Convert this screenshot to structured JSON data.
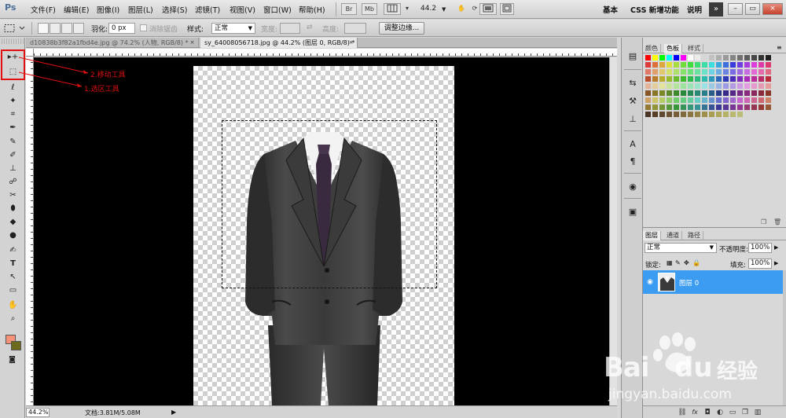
{
  "app": {
    "logo": "Ps"
  },
  "menu": [
    "文件(F)",
    "编辑(E)",
    "图像(I)",
    "图层(L)",
    "选择(S)",
    "滤镜(T)",
    "视图(V)",
    "窗口(W)",
    "帮助(H)"
  ],
  "app_bar": {
    "br": "Br",
    "mb": "Mb",
    "zoom": "44.2",
    "zoom_arrow": "▼"
  },
  "workspaces": [
    "基本",
    "CSS 新增功能",
    "说明"
  ],
  "window": {
    "more": "»",
    "minimize": "–",
    "restore": "▭",
    "close": "×"
  },
  "options": {
    "feather_label": "羽化:",
    "feather_value": "0 px",
    "antialias_label": "消除锯齿",
    "style_label": "样式:",
    "style_value": "正常",
    "width_label": "宽度:",
    "height_label": "高度:",
    "refine_button": "调整边缘..."
  },
  "doc_tabs": [
    {
      "title": "d10838b3f82a1fbd4e.jpg @ 74.2% (人物, RGB/8) *",
      "close": "×",
      "active": false
    },
    {
      "title": "sy_64008056718.jpg @ 44.2% (图层 0, RGB/8) *",
      "close": "×",
      "active": true
    }
  ],
  "tools": [
    "▸+",
    "⬚",
    "ℓ",
    "✦",
    "⌗",
    "✒",
    "✎",
    "✐",
    "⊥",
    "☍",
    "✂",
    "⬮",
    "◆",
    "●",
    "✍",
    "T",
    "↖",
    "▭",
    "✋",
    "⌕"
  ],
  "annotations": {
    "move_tool": "2.移动工具",
    "marquee_tool": "1.选区工具"
  },
  "status": {
    "zoom": "44.2%",
    "doc": "文档:3.81M/5.08M"
  },
  "swatches_panel": {
    "tabs": [
      "颜色",
      "色板",
      "样式"
    ],
    "active_tab": 1
  },
  "layers_panel": {
    "tabs": [
      "图层",
      "通道",
      "路径"
    ],
    "blend_mode": "正常",
    "opacity_label": "不透明度:",
    "opacity_value": "100%",
    "lock_label": "锁定:",
    "fill_label": "填充:",
    "fill_value": "100%",
    "layer_name": "图层 0",
    "footer_icons": [
      "link-icon",
      "fx-icon",
      "mask-icon",
      "adjustment-icon",
      "folder-icon",
      "new-layer-icon",
      "trash-icon"
    ]
  },
  "dock_icons": [
    "history-icon",
    "actions-icon",
    "tool-presets-icon",
    "clone-source-icon",
    "character-icon",
    "paragraph-icon",
    "navigator-icon",
    "info-icon"
  ],
  "watermark": {
    "brand": "Bai",
    "brand2": "du",
    "cn": "经验",
    "url": "jingyan.baidu.com"
  },
  "colors": {
    "foreground": "#f4937a",
    "background": "#6b6a1c",
    "selected_layer": "#3b9cf2",
    "annotation": "#e01010"
  }
}
